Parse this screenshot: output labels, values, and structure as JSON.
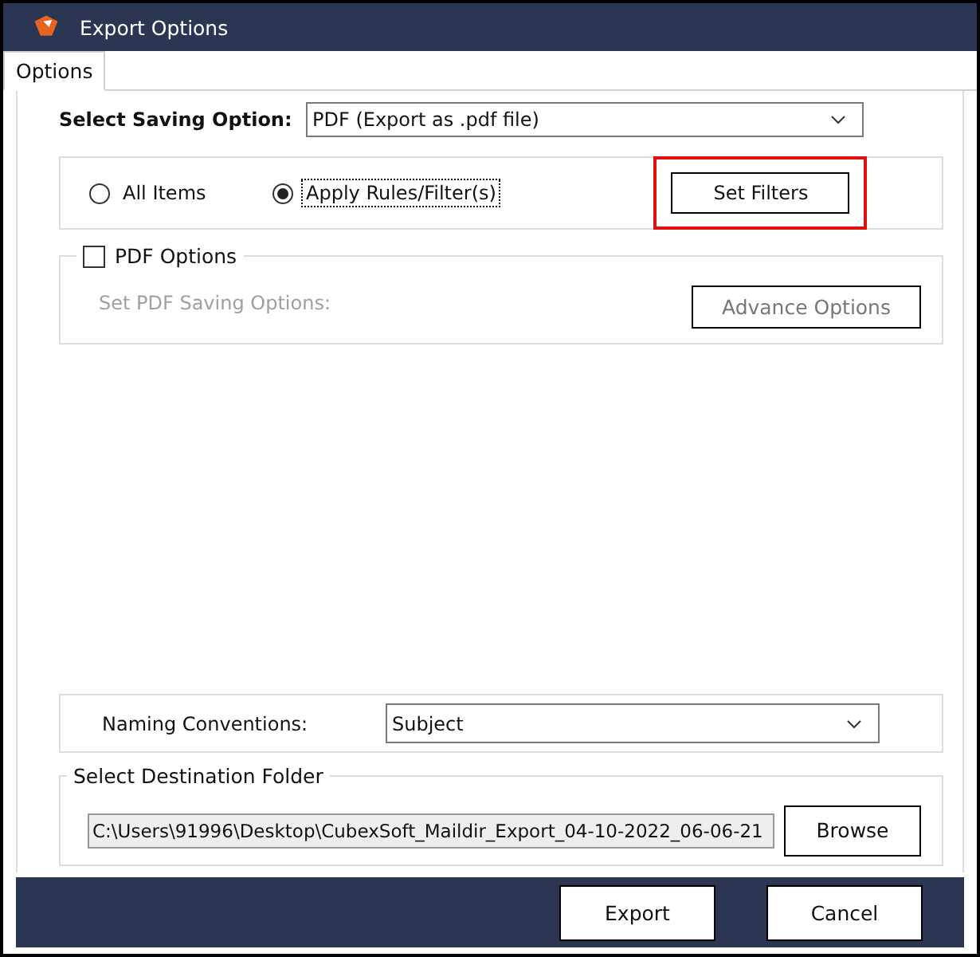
{
  "window": {
    "title": "Export Options"
  },
  "tabs": [
    {
      "label": "Options",
      "selected": true
    }
  ],
  "saving_option": {
    "label": "Select Saving Option:",
    "value": "PDF (Export as .pdf file)"
  },
  "scope": {
    "options": [
      {
        "label": "All Items",
        "selected": false,
        "focused": false
      },
      {
        "label": "Apply Rules/Filter(s)",
        "selected": true,
        "focused": true
      }
    ],
    "filter_button": {
      "label": "Set Filters",
      "highlighted": true
    }
  },
  "pdf_options": {
    "label": "PDF Options",
    "checked": false,
    "hint": "Set PDF Saving Options:",
    "button": {
      "label": "Advance Options"
    }
  },
  "naming": {
    "label": "Naming Conventions:",
    "value": "Subject"
  },
  "destination": {
    "legend": "Select Destination Folder",
    "path": "C:\\Users\\91996\\Desktop\\CubexSoft_Maildir_Export_04-10-2022_06-06-21",
    "button": "Browse"
  },
  "buttons": [
    "Export",
    "Cancel"
  ]
}
